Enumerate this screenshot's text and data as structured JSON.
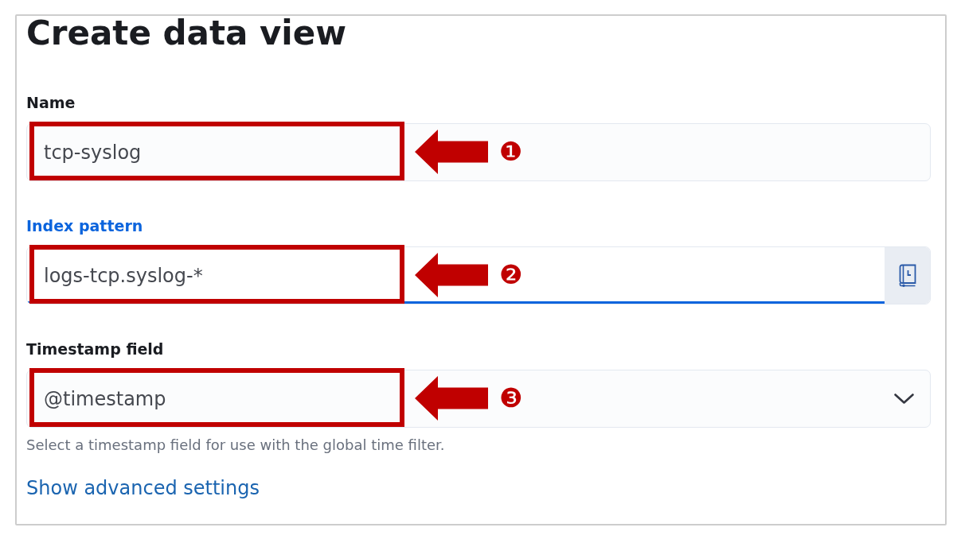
{
  "title": "Create data view",
  "fields": [
    {
      "kind": "text",
      "label": "Name",
      "value": "tcp-syslog",
      "focused": false,
      "callout": "❶"
    },
    {
      "kind": "text-append",
      "label": "Index pattern",
      "value": "logs-tcp.syslog-*",
      "focused": true,
      "callout": "❷"
    },
    {
      "kind": "select",
      "label": "Timestamp field",
      "value": "@timestamp",
      "focused": false,
      "callout": "❸",
      "help": "Select a timestamp field for use with the global time filter."
    }
  ],
  "advanced_link": "Show advanced settings"
}
